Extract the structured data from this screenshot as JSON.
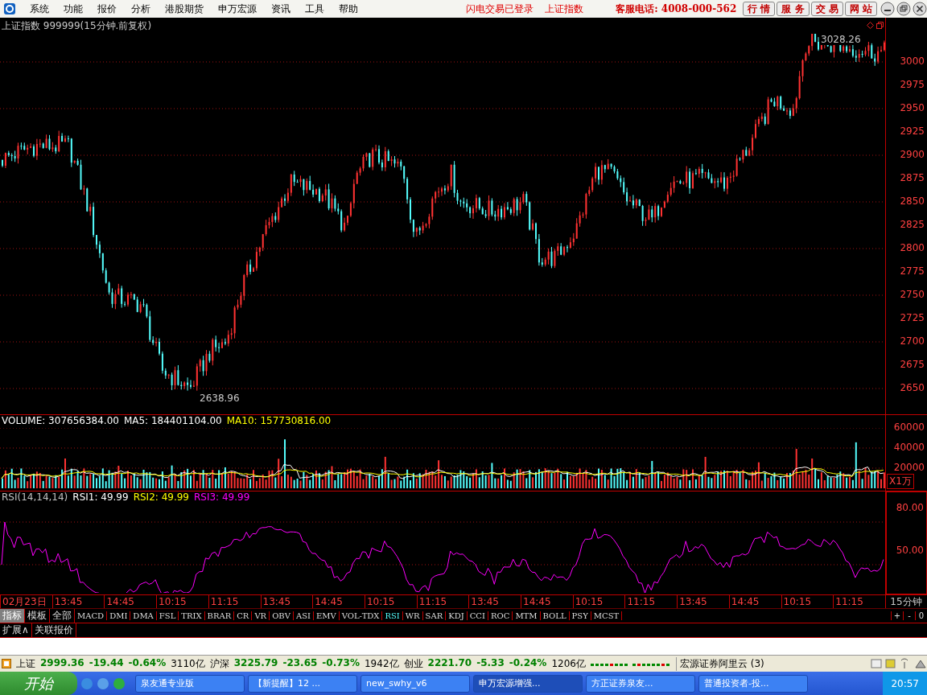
{
  "menu": {
    "items": [
      "系统",
      "功能",
      "报价",
      "分析",
      "港股期货",
      "申万宏源",
      "资讯",
      "工具",
      "帮助"
    ],
    "notices": [
      "闪电交易已登录",
      "上证指数"
    ],
    "hotline": "客服电话: 4008-000-562",
    "nav_buttons": [
      "行 情",
      "服 务",
      "交 易",
      "网 站"
    ]
  },
  "chart": {
    "title": "上证指数 999999(15分钟.前复权)",
    "price_axis": [
      "3000",
      "2975",
      "2950",
      "2925",
      "2900",
      "2875",
      "2850",
      "2825",
      "2800",
      "2775",
      "2750",
      "2725",
      "2700",
      "2675",
      "2650"
    ],
    "high_label": "3028.26",
    "low_label": "2638.96"
  },
  "volume": {
    "legend": [
      {
        "text": "VOLUME: 307656384.00",
        "color": "#ffffff"
      },
      {
        "text": "MA5: 184401104.00",
        "color": "#ffffff"
      },
      {
        "text": "MA10: 157730816.00",
        "color": "#ffff00"
      }
    ],
    "axis": [
      "60000",
      "40000",
      "20000"
    ],
    "unit": "X1万"
  },
  "rsi": {
    "legend": [
      {
        "text": "RSI(14,14,14)",
        "color": "#c0c0c0"
      },
      {
        "text": "RSI1: 49.99",
        "color": "#ffffff"
      },
      {
        "text": "RSI2: 49.99",
        "color": "#ffff00"
      },
      {
        "text": "RSI3: 49.99",
        "color": "#ff00ff"
      }
    ],
    "axis": [
      "80.00",
      "50.00"
    ]
  },
  "time_axis": {
    "labels": [
      "02月23日",
      "13:45",
      "14:45",
      "10:15",
      "11:15",
      "13:45",
      "14:45",
      "10:15",
      "11:15",
      "13:45",
      "14:45",
      "10:15",
      "11:15",
      "13:45",
      "14:45",
      "10:15",
      "11:15"
    ],
    "period": "15分钟"
  },
  "category_tabs": [
    {
      "label": "指标",
      "selected": true
    },
    {
      "label": "模板",
      "selected": false
    },
    {
      "label": "全部",
      "selected": false
    }
  ],
  "indicators": [
    {
      "label": "MACD",
      "selected": false
    },
    {
      "label": "DMI",
      "selected": false
    },
    {
      "label": "DMA",
      "selected": false
    },
    {
      "label": "FSL",
      "selected": false
    },
    {
      "label": "TRIX",
      "selected": false
    },
    {
      "label": "BRAR",
      "selected": false
    },
    {
      "label": "CR",
      "selected": false
    },
    {
      "label": "VR",
      "selected": false
    },
    {
      "label": "OBV",
      "selected": false
    },
    {
      "label": "ASI",
      "selected": false
    },
    {
      "label": "EMV",
      "selected": false
    },
    {
      "label": "VOL-TDX",
      "selected": false
    },
    {
      "label": "RSI",
      "selected": true
    },
    {
      "label": "WR",
      "selected": false
    },
    {
      "label": "SAR",
      "selected": false
    },
    {
      "label": "KDJ",
      "selected": false
    },
    {
      "label": "CCI",
      "selected": false
    },
    {
      "label": "ROC",
      "selected": false
    },
    {
      "label": "MTM",
      "selected": false
    },
    {
      "label": "BOLL",
      "selected": false
    },
    {
      "label": "PSY",
      "selected": false
    },
    {
      "label": "MCST",
      "selected": false
    }
  ],
  "zoom_buttons": [
    "+",
    "-",
    "0"
  ],
  "extra_tabs": [
    "扩展∧",
    "关联报价"
  ],
  "status_bar": {
    "indices": [
      {
        "name": "上证",
        "value": "2999.36",
        "change": "-19.44",
        "percent": "-0.64%",
        "amount": "3110亿"
      },
      {
        "name": "沪深",
        "value": "3225.79",
        "change": "-23.65",
        "percent": "-0.73%",
        "amount": "1942亿"
      },
      {
        "name": "创业",
        "value": "2221.70",
        "change": "-5.33",
        "percent": "-0.24%",
        "amount": "1206亿"
      }
    ],
    "server": "宏源证券阿里云 (3)"
  },
  "taskbar": {
    "start": "开始",
    "tasks": [
      {
        "label": "泉友通专业版",
        "selected": false
      },
      {
        "label": "【新提醒】12 ...",
        "selected": false
      },
      {
        "label": "new_swhy_v6",
        "selected": false
      },
      {
        "label": "申万宏源增强...",
        "selected": true
      },
      {
        "label": "方正证券泉友...",
        "selected": false
      },
      {
        "label": "普通投资者-投...",
        "selected": false
      }
    ],
    "clock": "20:57"
  }
}
